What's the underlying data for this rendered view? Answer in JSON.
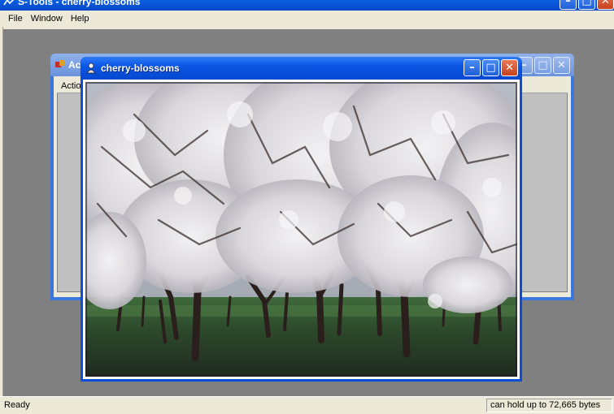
{
  "app": {
    "title": "S-Tools - cherry-blossoms",
    "icon": "s-tools-app-icon"
  },
  "menu": {
    "items": [
      "File",
      "Window",
      "Help"
    ]
  },
  "actions_window": {
    "title": "Ac",
    "header_label": "Action"
  },
  "image_window": {
    "title": "cherry-blossoms",
    "icon": "image-window-icon",
    "content": "photo of cherry blossom trees"
  },
  "window_controls": {
    "minimize": "–",
    "maximize": "□",
    "close": "✕"
  },
  "status": {
    "left": "Ready",
    "right": "can hold up to 72,665 bytes"
  },
  "colors": {
    "title_active": "#0b56e3",
    "title_inactive": "#7a9fe0",
    "close_button": "#c8401c",
    "workspace": "#808080",
    "chrome": "#ece9d8"
  }
}
